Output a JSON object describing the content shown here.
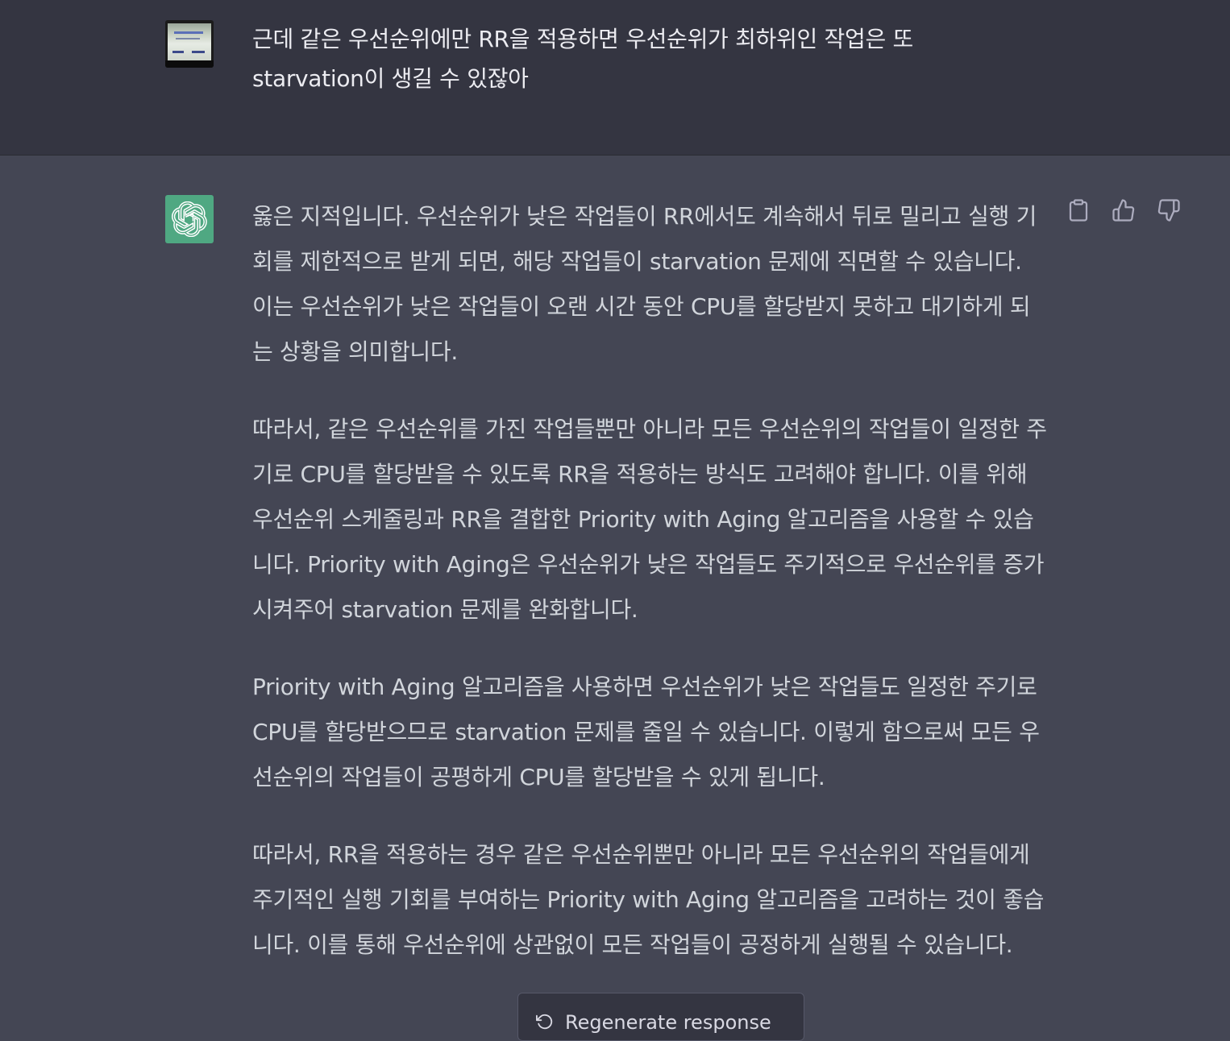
{
  "user_message": {
    "avatar_icon": "user-photo-avatar",
    "text": "근데 같은 우선순위에만 RR을 적용하면 우선순위가 최하위인 작업은 또 starvation이 생길 수 있잖아"
  },
  "assistant_message": {
    "avatar_icon": "openai-logo-icon",
    "paragraphs": [
      "옳은 지적입니다. 우선순위가 낮은 작업들이 RR에서도 계속해서 뒤로 밀리고 실행 기회를 제한적으로 받게 되면, 해당 작업들이 starvation 문제에 직면할 수 있습니다. 이는 우선순위가 낮은 작업들이 오랜 시간 동안 CPU를 할당받지 못하고 대기하게 되는 상황을 의미합니다.",
      "따라서, 같은 우선순위를 가진 작업들뿐만 아니라 모든 우선순위의 작업들이 일정한 주기로 CPU를 할당받을 수 있도록 RR을 적용하는 방식도 고려해야 합니다. 이를 위해 우선순위 스케줄링과 RR을 결합한 Priority with Aging 알고리즘을 사용할 수 있습니다. Priority with Aging은 우선순위가 낮은 작업들도 주기적으로 우선순위를 증가시켜주어 starvation 문제를 완화합니다.",
      "Priority with Aging 알고리즘을 사용하면 우선순위가 낮은 작업들도 일정한 주기로 CPU를 할당받으므로 starvation 문제를 줄일 수 있습니다. 이렇게 함으로써 모든 우선순위의 작업들이 공평하게 CPU를 할당받을 수 있게 됩니다.",
      "따라서, RR을 적용하는 경우 같은 우선순위뿐만 아니라 모든 우선순위의 작업들에게 주기적인 실행 기회를 부여하는 Priority with Aging 알고리즘을 고려하는 것이 좋습니다. 이를 통해 우선순위에 상관없이 모든 작업들이 공정하게 실행될 수 있습니다."
    ],
    "actions": {
      "copy_icon": "clipboard-icon",
      "like_icon": "thumbs-up-icon",
      "dislike_icon": "thumbs-down-icon"
    }
  },
  "regenerate": {
    "label": "Regenerate response",
    "icon": "refresh-icon"
  }
}
